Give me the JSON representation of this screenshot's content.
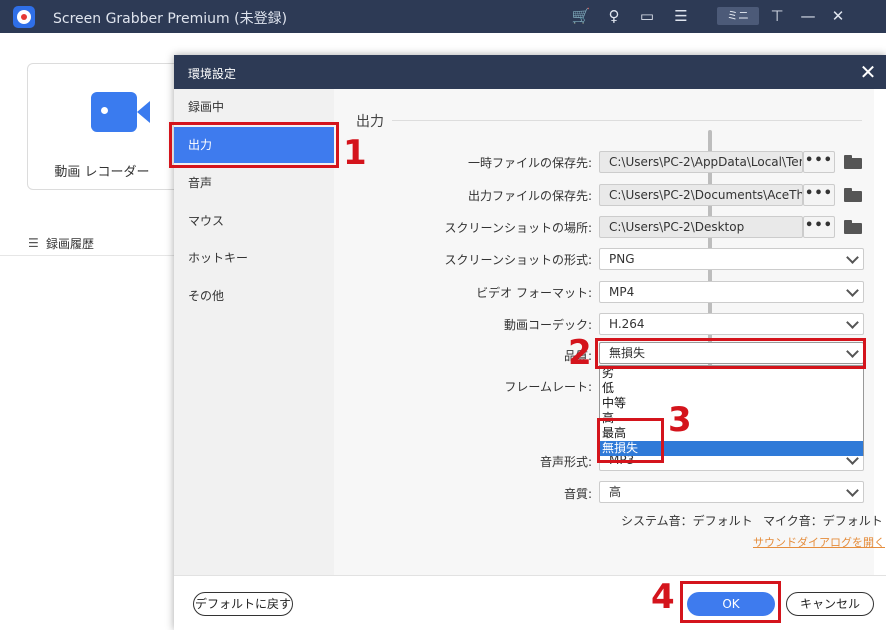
{
  "app": {
    "title": "Screen Grabber Premium (未登録)",
    "mini_label": "ミニ",
    "icons": [
      "cart-icon",
      "key-icon",
      "chat-icon",
      "menu-icon",
      "pin-icon",
      "minimize-icon",
      "close-icon"
    ],
    "recorder_label": "動画 レコーダー",
    "history_label": "録画履歴"
  },
  "dialog": {
    "title": "環境設定",
    "sidebar": [
      {
        "label": "録画中"
      },
      {
        "label": "出力"
      },
      {
        "label": "音声"
      },
      {
        "label": "マウス"
      },
      {
        "label": "ホットキー"
      },
      {
        "label": "その他"
      }
    ],
    "active_item": "出力",
    "section_title": "出力",
    "rows": {
      "temp_folder": {
        "label": "一時ファイルの保存先:",
        "value": "C:\\Users\\PC-2\\AppData\\Local\\Tem"
      },
      "output_folder": {
        "label": "出力ファイルの保存先:",
        "value": "C:\\Users\\PC-2\\Documents\\AceThir"
      },
      "screenshot_folder": {
        "label": "スクリーンショットの場所:",
        "value": "C:\\Users\\PC-2\\Desktop"
      },
      "screenshot_format": {
        "label": "スクリーンショットの形式:",
        "value": "PNG"
      },
      "video_format": {
        "label": "ビデオ フォーマット:",
        "value": "MP4"
      },
      "video_codec": {
        "label": "動画コーデック:",
        "value": "H.264"
      },
      "quality": {
        "label": "品質:",
        "value": "無損失"
      },
      "frame_rate": {
        "label": "フレームレート:"
      },
      "audio_format": {
        "label": "音声形式:",
        "value": "MP3"
      },
      "audio_quality": {
        "label": "音質:",
        "value": "高"
      }
    },
    "dots_label": "•••",
    "quality_options": [
      "劣",
      "低",
      "中等",
      "高",
      "最高",
      "無損失"
    ],
    "quality_selected": "無損失",
    "system_audio": "システム音：デフォルト",
    "mic_audio": "マイク音：デフォルト",
    "sound_dialog_link": "サウンドダイアログを開く",
    "footer": {
      "reset_label": "デフォルトに戻す",
      "ok_label": "OK",
      "cancel_label": "キャンセル"
    }
  },
  "annotations": [
    "1",
    "2",
    "3",
    "4"
  ],
  "colors": {
    "titlebar": "#2d3a55",
    "accent": "#3e7bee",
    "annotation_red": "#d4141c",
    "link_orange": "#e58d3c"
  }
}
